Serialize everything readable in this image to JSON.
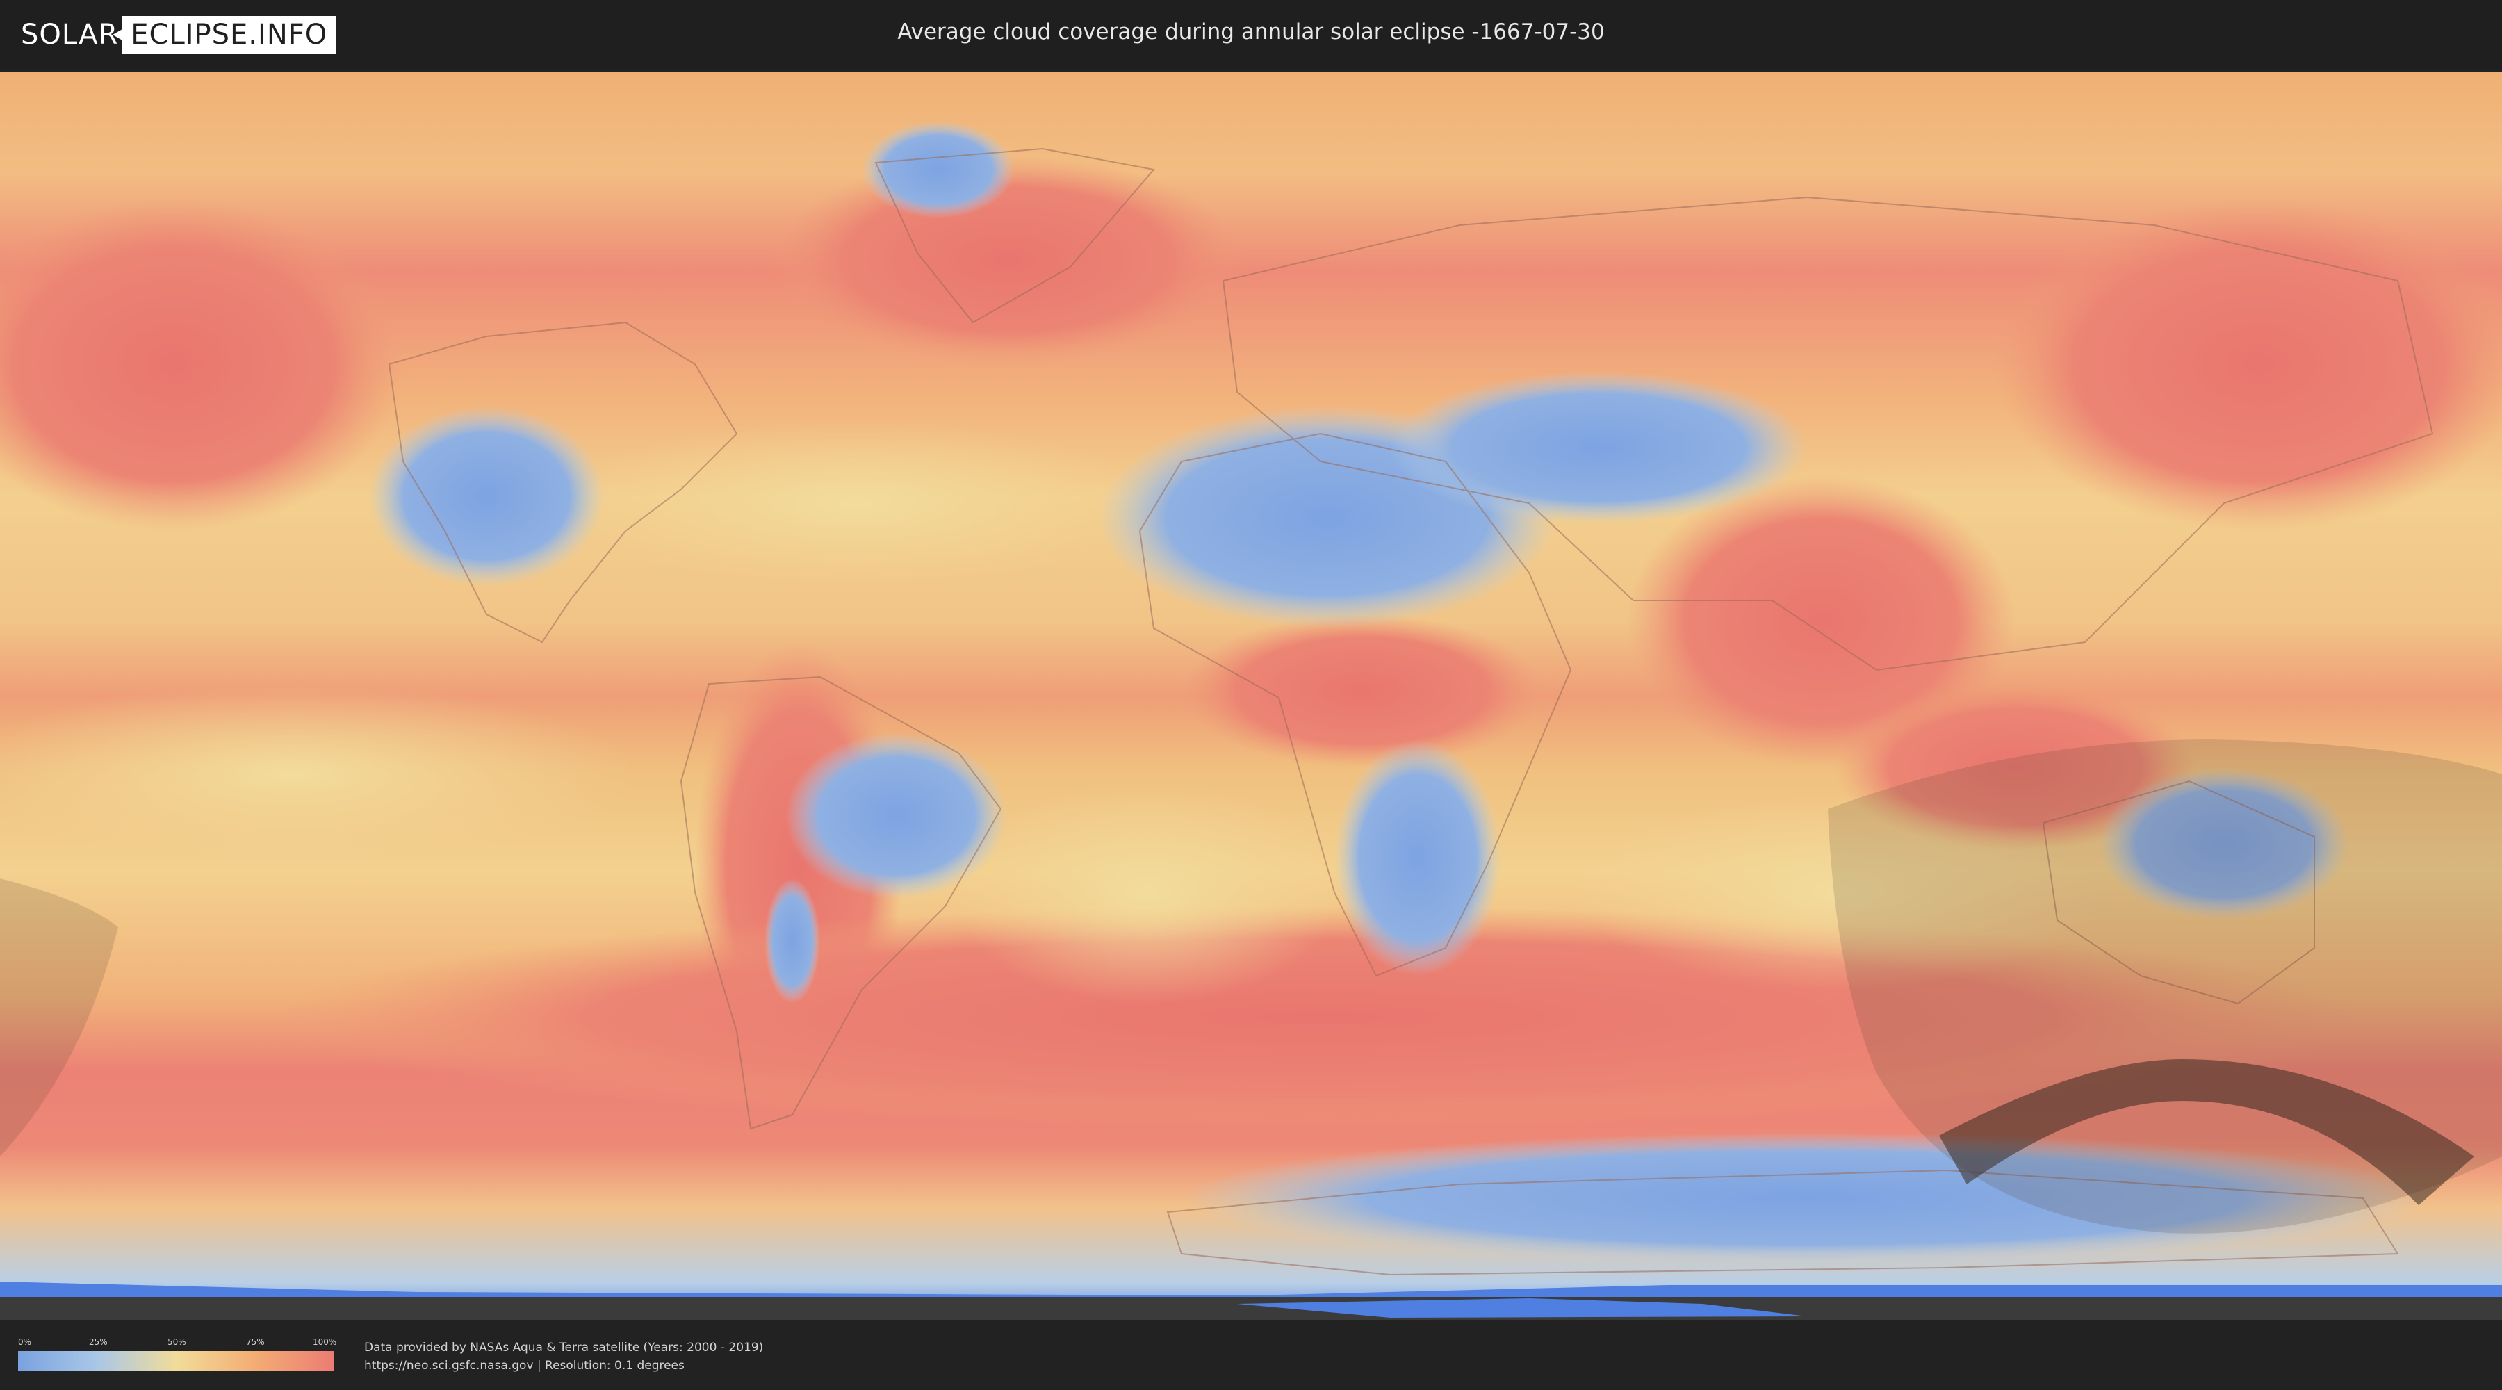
{
  "header": {
    "logo_left": "SOLAR",
    "logo_right": "ECLIPSE.INFO",
    "title": "Average cloud coverage during annular solar eclipse -1667-07-30"
  },
  "legend": {
    "ticks": [
      "0%",
      "25%",
      "50%",
      "75%",
      "100%"
    ],
    "colors": [
      "#7aa2e0",
      "#a9c7e6",
      "#f1dc9a",
      "#f3ad74",
      "#ec7c74"
    ]
  },
  "credits": {
    "line1": "Data provided by NASAs Aqua & Terra satellite (Years: 2000 - 2019)",
    "line2": "https://neo.sci.gsfc.nasa.gov | Resolution: 0.1 degrees"
  },
  "map": {
    "projection": "equirectangular",
    "layers": [
      "cloud-coverage",
      "country-borders",
      "eclipse-visibility-zone",
      "annular-path"
    ],
    "colors": {
      "clear": "#7aa2e0",
      "low": "#a9c7e6",
      "mid": "#f1dc9a",
      "high": "#f3ad74",
      "overcast": "#ec7c74",
      "ice": "#4f7fe0",
      "shadow": "#3a2a20"
    }
  }
}
